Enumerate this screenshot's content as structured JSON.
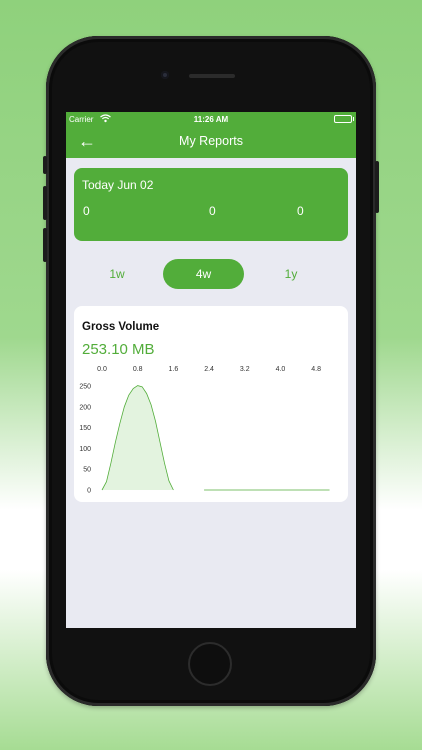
{
  "status_bar": {
    "carrier": "Carrier",
    "time": "11:26 AM"
  },
  "nav": {
    "back_icon": "arrow-left-icon",
    "title": "My Reports"
  },
  "today": {
    "title": "Today Jun 02",
    "values": [
      "0",
      "0",
      "0"
    ]
  },
  "periods": {
    "options": [
      "1w",
      "4w",
      "1y"
    ],
    "selected": "4w"
  },
  "gross_volume": {
    "title": "Gross Volume",
    "value": "253.10 MB"
  },
  "colors": {
    "accent": "#52ad3a",
    "area_fill": "#e3f3df",
    "screen_bg": "#e9eaf2"
  },
  "chart_data": {
    "type": "area",
    "x_ticks": [
      "0.0",
      "0.8",
      "1.6",
      "2.4",
      "3.2",
      "4.0",
      "4.8"
    ],
    "y_ticks": [
      "0",
      "50",
      "100",
      "150",
      "200",
      "250"
    ],
    "xlim": [
      0,
      5.2
    ],
    "ylim": [
      0,
      250
    ],
    "x_axis_position": "top",
    "grid": false,
    "series": [
      {
        "points": [
          [
            0.0,
            0
          ],
          [
            0.1,
            20
          ],
          [
            0.2,
            65
          ],
          [
            0.3,
            115
          ],
          [
            0.4,
            160
          ],
          [
            0.5,
            200
          ],
          [
            0.6,
            228
          ],
          [
            0.7,
            244
          ],
          [
            0.8,
            251
          ],
          [
            0.9,
            248
          ],
          [
            1.0,
            232
          ],
          [
            1.1,
            205
          ],
          [
            1.2,
            165
          ],
          [
            1.3,
            115
          ],
          [
            1.4,
            65
          ],
          [
            1.5,
            22
          ],
          [
            1.6,
            0
          ],
          [
            2.4,
            0
          ],
          [
            3.2,
            0
          ],
          [
            4.0,
            0
          ],
          [
            4.8,
            0
          ],
          [
            5.1,
            0
          ]
        ]
      }
    ]
  }
}
